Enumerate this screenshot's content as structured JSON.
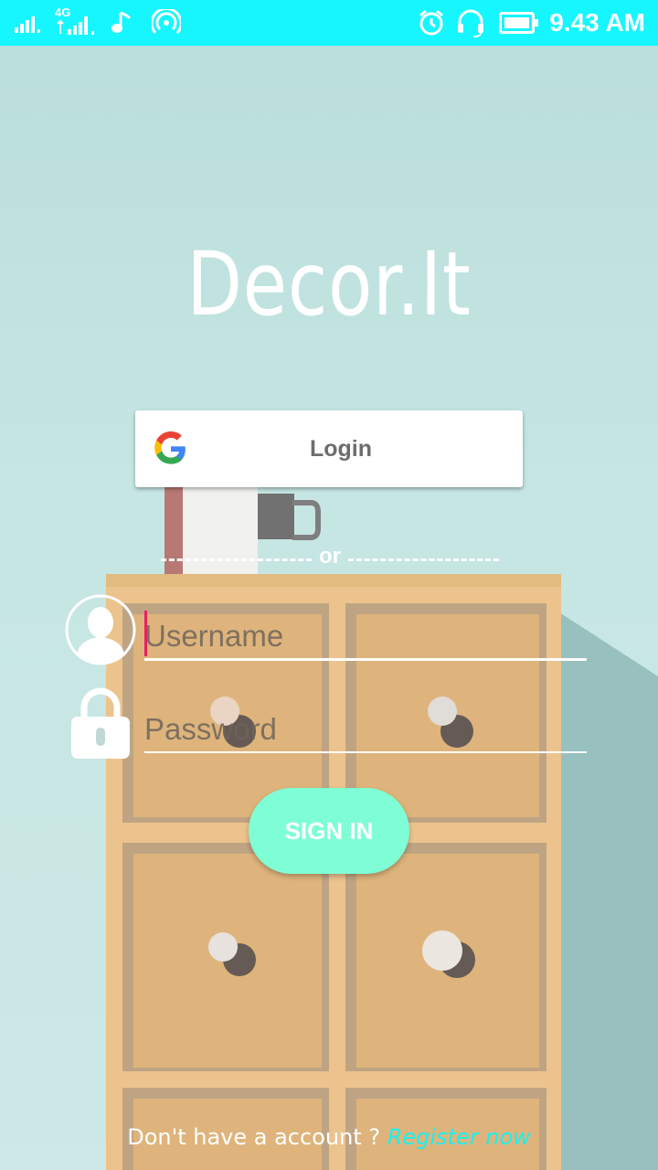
{
  "status_bar": {
    "network_type": "4G",
    "time": "9.43 AM",
    "icons": [
      "signal-icon",
      "4g-signal-icon",
      "music-note-icon",
      "hotspot-icon",
      "alarm-icon",
      "headset-icon",
      "battery-icon"
    ]
  },
  "app": {
    "title": "Decor.It"
  },
  "google_login": {
    "label": "Login",
    "icon": "google-icon"
  },
  "divider": {
    "text": "or"
  },
  "form": {
    "username": {
      "placeholder": "Username",
      "value": "",
      "icon": "user-avatar-icon"
    },
    "password": {
      "placeholder": "Password",
      "value": "",
      "icon": "lock-icon"
    },
    "submit_label": "SIGN IN"
  },
  "footer": {
    "prompt": "Don't have a account ?",
    "link": "Register now"
  },
  "colors": {
    "status_bar": "#16f6ff",
    "sign_in_button": "#7ffed5",
    "register_link": "#19f0f0",
    "caret": "#e91e63"
  }
}
